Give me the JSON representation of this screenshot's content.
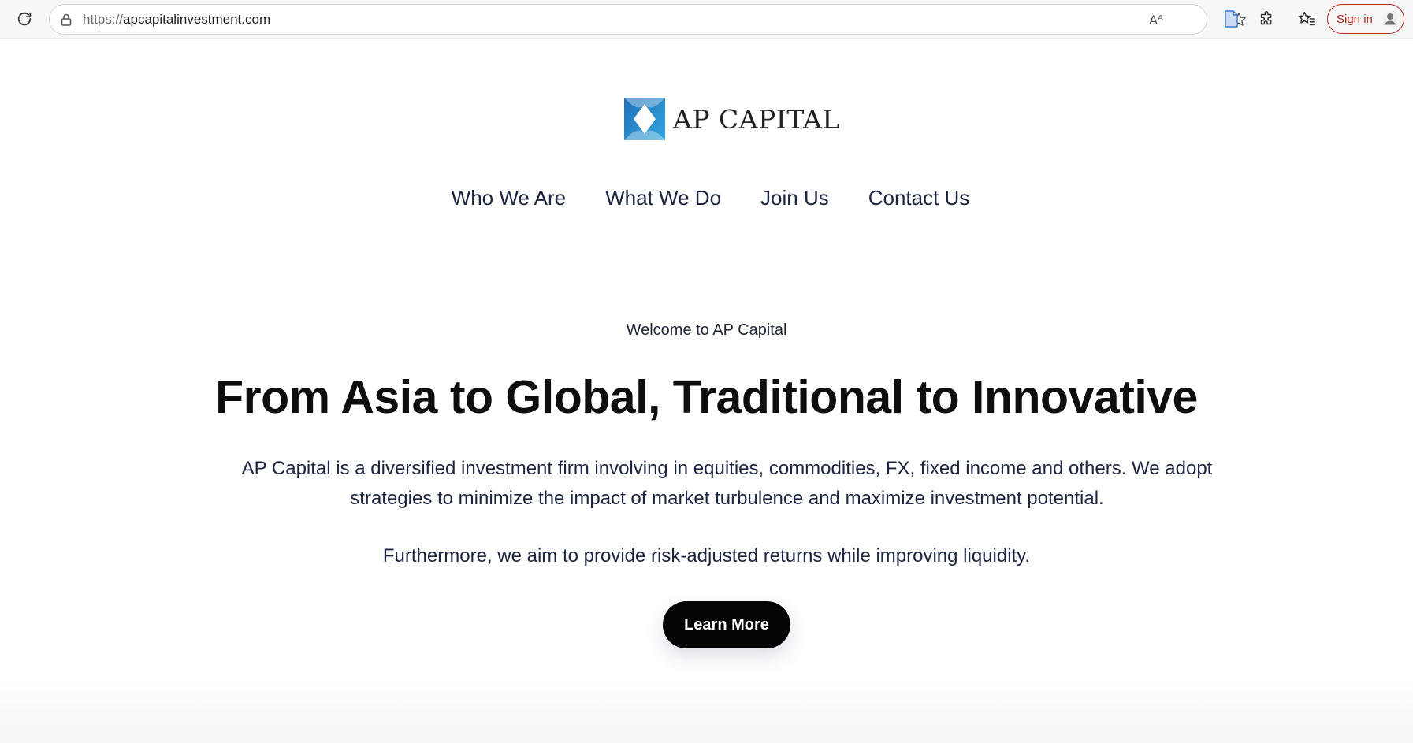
{
  "browser": {
    "url_protocol": "https://",
    "url_host": "apcapitalinvestment.com",
    "sign_in_label": "Sign in",
    "read_aloud_glyph": "Aᴬ"
  },
  "site": {
    "logo_text": "AP CAPITAL",
    "logo_colors": [
      "#1d6fb8",
      "#35a5dc"
    ],
    "nav": [
      {
        "label": "Who We Are"
      },
      {
        "label": "What We Do"
      },
      {
        "label": "Join Us"
      },
      {
        "label": "Contact Us"
      }
    ]
  },
  "hero": {
    "eyebrow": "Welcome to AP Capital",
    "headline": "From Asia to Global, Traditional to Innovative",
    "paragraph": "AP Capital is a diversified investment firm involving in equities, commodities, FX, fixed income and others. We adopt strategies to minimize the impact of market turbulence and maximize investment potential.",
    "paragraph2": "Furthermore, we aim to provide risk-adjusted returns while improving liquidity.",
    "cta_label": "Learn More"
  }
}
